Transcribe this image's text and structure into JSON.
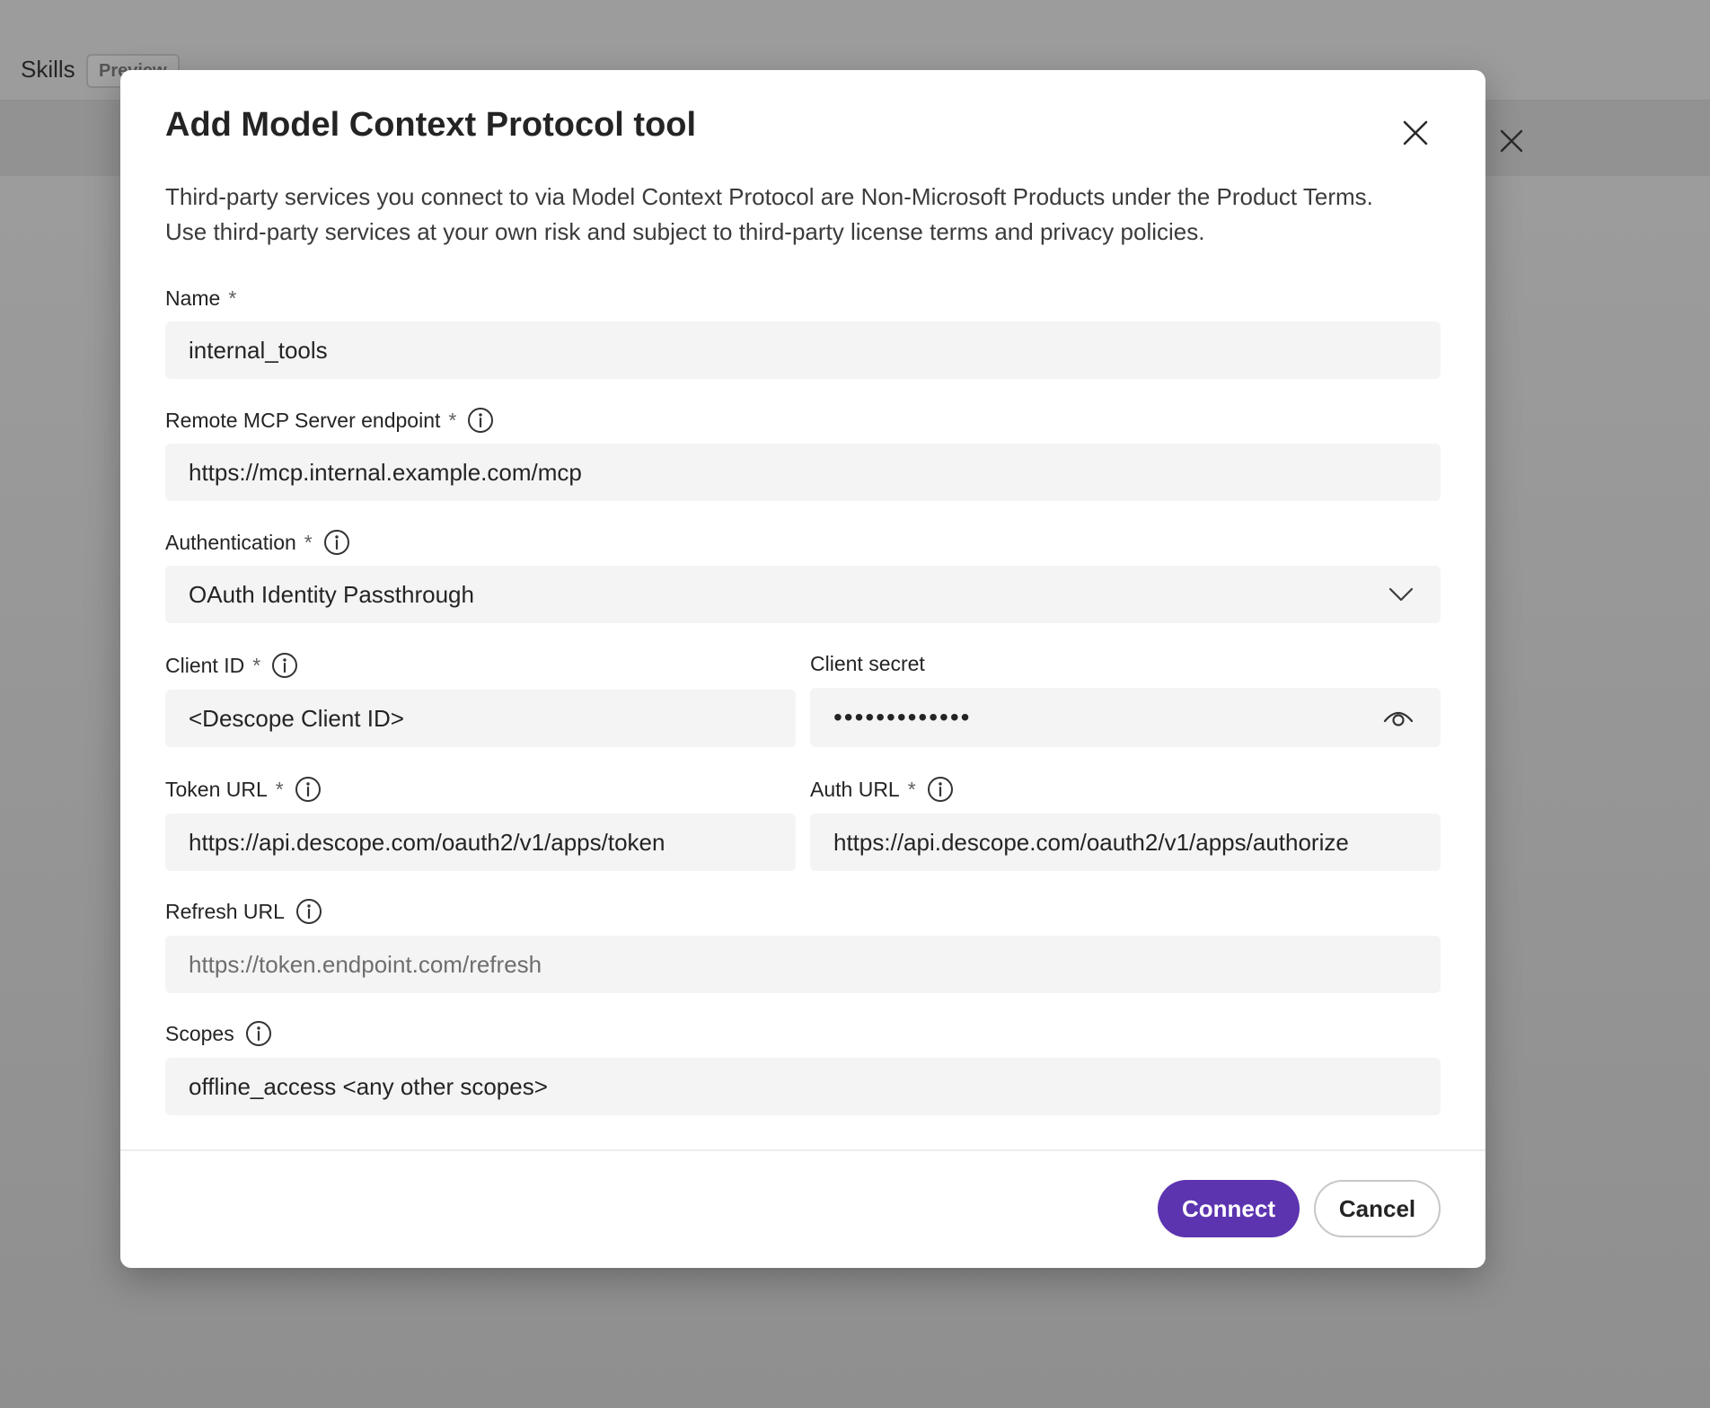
{
  "background": {
    "title": "Skills",
    "badge": "Preview"
  },
  "dialog": {
    "title": "Add Model Context Protocol tool",
    "disclaimer_line1": "Third-party services you connect to via Model Context Protocol are Non-Microsoft Products under the Product Terms.",
    "disclaimer_line2": "Use third-party services at your own risk and subject to third-party license terms and privacy policies.",
    "required_marker": "*",
    "fields": {
      "name": {
        "label": "Name",
        "value": "internal_tools"
      },
      "endpoint": {
        "label": "Remote MCP Server endpoint",
        "value": "https://mcp.internal.example.com/mcp"
      },
      "authentication": {
        "label": "Authentication",
        "value": "OAuth Identity Passthrough"
      },
      "client_id": {
        "label": "Client ID",
        "value": "<Descope Client ID>"
      },
      "client_secret": {
        "label": "Client secret",
        "value": "•••••••••••••"
      },
      "token_url": {
        "label": "Token URL",
        "value": "https://api.descope.com/oauth2/v1/apps/token"
      },
      "auth_url": {
        "label": "Auth URL",
        "value": "https://api.descope.com/oauth2/v1/apps/authorize"
      },
      "refresh_url": {
        "label": "Refresh URL",
        "placeholder": "https://token.endpoint.com/refresh"
      },
      "scopes": {
        "label": "Scopes",
        "value": "offline_access <any other scopes>"
      }
    },
    "buttons": {
      "connect": "Connect",
      "cancel": "Cancel"
    }
  },
  "colors": {
    "primary": "#5c34b0",
    "input_bg": "#f4f4f4",
    "overlay": "#9a9a9a"
  },
  "icons": [
    "close-icon",
    "info-icon",
    "chevron-down-icon",
    "eye-icon"
  ]
}
